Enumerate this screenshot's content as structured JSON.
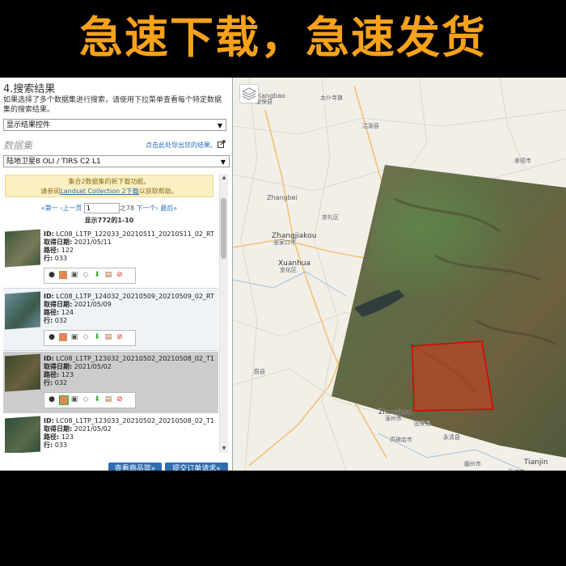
{
  "banner": {
    "text": "急速下载，急速发货"
  },
  "panel": {
    "title": "4.搜索结果",
    "description": "如果选择了多个数据集进行搜索，请使用下拉菜单查看每个特定数据集的搜索结果。",
    "display_control": "显示结果控件",
    "dataset_label": "数据集",
    "export_link": "点击此处导出您的结果。",
    "dataset_select": "陆地卫星8 OLI / TIRS C2 L1",
    "notice_line1": "集合2数据集的新下载功能。",
    "notice_line2_pre": "请参阅",
    "notice_link": "Landsat Collection 2下载",
    "notice_line2_post": "以获取帮助。",
    "pager": {
      "first": "«第一",
      "prev": "‹上一页",
      "page": "1",
      "of": "之78",
      "next": "下一个›",
      "last": "最后»"
    },
    "count": "显示772的1-10",
    "labels": {
      "id": "ID:",
      "date": "取得日期:",
      "path": "路径:",
      "row": "行:"
    },
    "results": [
      {
        "id": "LC08_L1TP_122033_20210511_20210511_02_RT",
        "date": "2021/05/11",
        "path": "122",
        "row": "033"
      },
      {
        "id": "LC08_L1TP_124032_20210509_20210509_02_RT",
        "date": "2021/05/09",
        "path": "124",
        "row": "032"
      },
      {
        "id": "LC08_L1TP_123032_20210502_20210508_02_T1",
        "date": "2021/05/02",
        "path": "123",
        "row": "032"
      },
      {
        "id": "LC08_L1TP_123033_20210502_20210508_02_T1",
        "date": "2021/05/02",
        "path": "123",
        "row": "033"
      }
    ],
    "buttons": {
      "view_items": "查看商品篮»",
      "submit": "提交订单请求»"
    }
  },
  "map": {
    "labels": [
      {
        "text": "Kangbao",
        "key": "a"
      },
      {
        "text": "康保县",
        "key": "b"
      },
      {
        "text": "太仆寺旗",
        "key": "c"
      },
      {
        "text": "沽源县",
        "key": "d"
      },
      {
        "text": "承德市",
        "key": "e"
      },
      {
        "text": "Zhangjiakou",
        "key": "f"
      },
      {
        "text": "张家口市",
        "key": "g"
      },
      {
        "text": "Xuanhua",
        "key": "h"
      },
      {
        "text": "宣化区",
        "key": "i"
      },
      {
        "text": "崇礼区",
        "key": "j"
      },
      {
        "text": "Zhangbei",
        "key": "k"
      },
      {
        "text": "Zhuozhou",
        "key": "l"
      },
      {
        "text": "涿州市",
        "key": "m"
      },
      {
        "text": "固安县",
        "key": "n"
      },
      {
        "text": "永清县",
        "key": "o"
      },
      {
        "text": "Tianjin",
        "key": "p"
      },
      {
        "text": "天津市",
        "key": "q"
      },
      {
        "text": "霸州市",
        "key": "r"
      },
      {
        "text": "高碑店市",
        "key": "s"
      },
      {
        "text": "蔚县",
        "key": "t"
      }
    ]
  }
}
